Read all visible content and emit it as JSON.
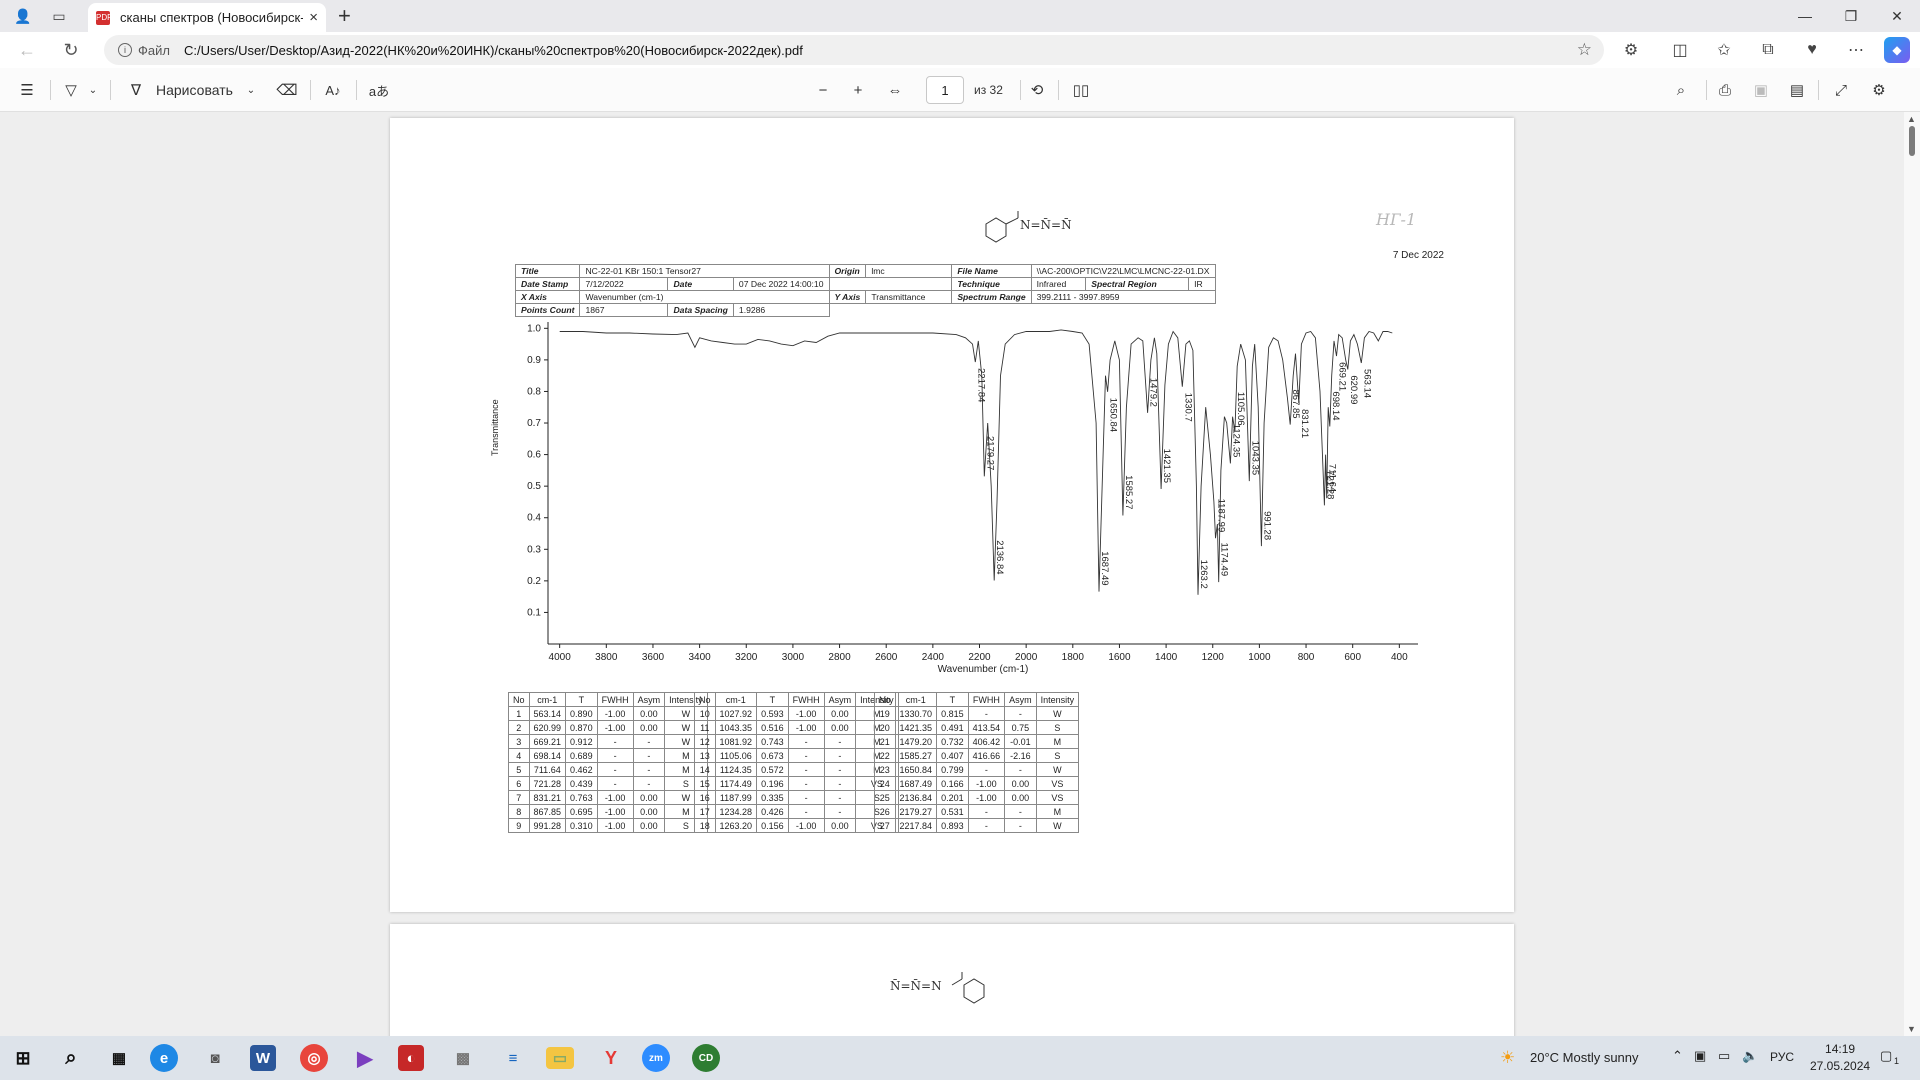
{
  "tab": {
    "title": "сканы спектров (Новосибирск-",
    "close": "×"
  },
  "window_controls": [
    "—",
    "❐",
    "✕"
  ],
  "address": {
    "file_label": "Файл",
    "url": "C:/Users/User/Desktop/Азид-2022(НК%20и%20ИНК)/сканы%20спектров%20(Новосибирск-2022дек).pdf"
  },
  "toolbar": {
    "draw_label": "Нарисовать",
    "page_current": "1",
    "page_total": "из 32"
  },
  "document": {
    "molecule_1": "N=N̄=N̄",
    "handwritten_id": "НГ-1",
    "date": "7 Dec 2022",
    "meta": {
      "title_k": "Title",
      "title_v": "NC-22-01 KBr 150:1 Tensor27",
      "datestamp_k": "Date Stamp",
      "datestamp_v": "7/12/2022",
      "date_k": "Date",
      "date_v": "07 Dec 2022 14:00:10",
      "xaxis_k": "X Axis",
      "xaxis_v": "Wavenumber (cm-1)",
      "points_k": "Points Count",
      "points_v": "1867",
      "spacing_k": "Data Spacing",
      "spacing_v": "1.9286",
      "origin_k": "Origin",
      "origin_v": "lmc",
      "yaxis_k": "Y Axis",
      "yaxis_v": "Transmittance",
      "file_k": "File Name",
      "file_v": "\\\\AC-200\\OPTIC\\V22\\LMC\\LMCNC-22-01.DX",
      "technique_k": "Technique",
      "technique_v": "Infrared",
      "region_k": "Spectral Region",
      "region_v": "IR",
      "range_k": "Spectrum Range",
      "range_v": "399.2111 - 3997.8959"
    },
    "molecule_2": "N̄=N̄=N"
  },
  "chart_data": {
    "type": "line",
    "title": "",
    "xlabel": "Wavenumber (cm-1)",
    "ylabel": "Transmittance",
    "xlim": [
      4050,
      320
    ],
    "ylim": [
      0,
      1.02
    ],
    "x_ticks": [
      4000,
      3800,
      3600,
      3400,
      3200,
      3000,
      2800,
      2600,
      2400,
      2200,
      2000,
      1800,
      1600,
      1400,
      1200,
      1000,
      800,
      600,
      400
    ],
    "y_ticks": [
      0.1,
      0.2,
      0.3,
      0.4,
      0.5,
      0.6,
      0.7,
      0.8,
      0.9,
      1.0
    ],
    "peak_labels": [
      {
        "x": 2217.84,
        "y": 0.893,
        "label": "2217.84"
      },
      {
        "x": 2179.27,
        "y": 0.531,
        "label": "2179.27"
      },
      {
        "x": 2136.84,
        "y": 0.201,
        "label": "2136.84"
      },
      {
        "x": 1687.49,
        "y": 0.166,
        "label": "1687.49"
      },
      {
        "x": 1650.84,
        "y": 0.799,
        "label": "1650.84"
      },
      {
        "x": 1585.27,
        "y": 0.407,
        "label": "1585.27"
      },
      {
        "x": 1479.2,
        "y": 0.732,
        "label": "1479.2"
      },
      {
        "x": 1421.35,
        "y": 0.491,
        "label": "1421.35"
      },
      {
        "x": 1330.7,
        "y": 0.815,
        "label": "1330.7"
      },
      {
        "x": 1263.2,
        "y": 0.156,
        "label": "1263.2"
      },
      {
        "x": 1187.99,
        "y": 0.335,
        "label": "1187.99"
      },
      {
        "x": 1174.49,
        "y": 0.196,
        "label": "1174.49"
      },
      {
        "x": 1124.35,
        "y": 0.572,
        "label": "1124.35"
      },
      {
        "x": 1105.06,
        "y": 0.673,
        "label": "1105.06"
      },
      {
        "x": 1043.35,
        "y": 0.516,
        "label": "1043.35"
      },
      {
        "x": 991.28,
        "y": 0.31,
        "label": "991.28"
      },
      {
        "x": 867.85,
        "y": 0.695,
        "label": "867.85"
      },
      {
        "x": 831.21,
        "y": 0.763,
        "label": "831.21"
      },
      {
        "x": 721.28,
        "y": 0.439,
        "label": "721.28"
      },
      {
        "x": 711.64,
        "y": 0.462,
        "label": "711.64"
      },
      {
        "x": 698.14,
        "y": 0.689,
        "label": "698.14"
      },
      {
        "x": 669.21,
        "y": 0.912,
        "label": "669.21"
      },
      {
        "x": 620.99,
        "y": 0.87,
        "label": "620.99"
      },
      {
        "x": 563.14,
        "y": 0.89,
        "label": "563.14"
      }
    ],
    "series": [
      {
        "x": [
          4000,
          3900,
          3800,
          3700,
          3600,
          3500,
          3450,
          3420,
          3400,
          3350,
          3300,
          3250,
          3200,
          3150,
          3100,
          3050,
          3000,
          2950,
          2900,
          2850,
          2800,
          2700,
          2600,
          2500,
          2400,
          2300,
          2260,
          2230,
          2217.84,
          2205,
          2190,
          2179.27,
          2165,
          2150,
          2136.84,
          2125,
          2110,
          2090,
          2050,
          2000,
          1950,
          1900,
          1850,
          1800,
          1760,
          1730,
          1700,
          1687.49,
          1670,
          1660,
          1650.84,
          1640,
          1620,
          1600,
          1585.27,
          1570,
          1550,
          1520,
          1500,
          1479.2,
          1465,
          1450,
          1440,
          1421.35,
          1405,
          1390,
          1370,
          1350,
          1330.7,
          1315,
          1300,
          1285,
          1270,
          1263.2,
          1250,
          1230,
          1210,
          1195,
          1187.99,
          1180,
          1174.49,
          1165,
          1150,
          1140,
          1124.35,
          1115,
          1105.06,
          1095,
          1080,
          1060,
          1043.35,
          1030,
          1020,
          1005,
          991.28,
          980,
          960,
          940,
          920,
          900,
          880,
          867.85,
          855,
          845,
          831.21,
          820,
          800,
          780,
          760,
          740,
          721.28,
          716,
          711.64,
          705,
          698.14,
          690,
          680,
          669.21,
          660,
          645,
          630,
          620.99,
          610,
          595,
          580,
          563.14,
          550,
          530,
          510,
          490,
          470,
          450,
          430
        ],
        "y": [
          0.99,
          0.99,
          0.985,
          0.985,
          0.982,
          0.98,
          0.985,
          0.94,
          0.97,
          0.96,
          0.955,
          0.95,
          0.95,
          0.965,
          0.96,
          0.95,
          0.945,
          0.96,
          0.955,
          0.975,
          0.985,
          0.985,
          0.985,
          0.985,
          0.985,
          0.98,
          0.97,
          0.95,
          0.893,
          0.96,
          0.85,
          0.531,
          0.7,
          0.5,
          0.201,
          0.45,
          0.85,
          0.95,
          0.98,
          0.99,
          0.99,
          0.99,
          0.995,
          0.99,
          0.985,
          0.95,
          0.7,
          0.166,
          0.6,
          0.85,
          0.799,
          0.9,
          0.96,
          0.9,
          0.407,
          0.75,
          0.95,
          0.97,
          0.96,
          0.732,
          0.9,
          0.97,
          0.92,
          0.491,
          0.82,
          0.95,
          0.99,
          0.97,
          0.815,
          0.95,
          0.96,
          0.93,
          0.5,
          0.156,
          0.5,
          0.75,
          0.6,
          0.45,
          0.335,
          0.38,
          0.196,
          0.55,
          0.72,
          0.7,
          0.572,
          0.72,
          0.673,
          0.88,
          0.95,
          0.9,
          0.516,
          0.88,
          0.95,
          0.75,
          0.31,
          0.7,
          0.94,
          0.97,
          0.96,
          0.9,
          0.78,
          0.695,
          0.85,
          0.92,
          0.763,
          0.95,
          0.985,
          0.99,
          0.97,
          0.8,
          0.439,
          0.6,
          0.462,
          0.75,
          0.689,
          0.85,
          0.96,
          0.912,
          0.98,
          0.97,
          0.9,
          0.87,
          0.96,
          0.98,
          0.95,
          0.89,
          0.97,
          0.99,
          0.985,
          0.96,
          0.99,
          0.99,
          0.985
        ]
      }
    ]
  },
  "peaks_table": {
    "headers": [
      "No",
      "cm-1",
      "T",
      "FWHH",
      "Asym",
      "Intensity"
    ],
    "columns": [
      [
        [
          "1",
          "563.14",
          "0.890",
          "-1.00",
          "0.00",
          "W"
        ],
        [
          "2",
          "620.99",
          "0.870",
          "-1.00",
          "0.00",
          "W"
        ],
        [
          "3",
          "669.21",
          "0.912",
          "-",
          "-",
          "W"
        ],
        [
          "4",
          "698.14",
          "0.689",
          "-",
          "-",
          "M"
        ],
        [
          "5",
          "711.64",
          "0.462",
          "-",
          "-",
          "M"
        ],
        [
          "6",
          "721.28",
          "0.439",
          "-",
          "-",
          "S"
        ],
        [
          "7",
          "831.21",
          "0.763",
          "-1.00",
          "0.00",
          "W"
        ],
        [
          "8",
          "867.85",
          "0.695",
          "-1.00",
          "0.00",
          "M"
        ],
        [
          "9",
          "991.28",
          "0.310",
          "-1.00",
          "0.00",
          "S"
        ]
      ],
      [
        [
          "10",
          "1027.92",
          "0.593",
          "-1.00",
          "0.00",
          "M"
        ],
        [
          "11",
          "1043.35",
          "0.516",
          "-1.00",
          "0.00",
          "M"
        ],
        [
          "12",
          "1081.92",
          "0.743",
          "-",
          "-",
          "M"
        ],
        [
          "13",
          "1105.06",
          "0.673",
          "-",
          "-",
          "M"
        ],
        [
          "14",
          "1124.35",
          "0.572",
          "-",
          "-",
          "M"
        ],
        [
          "15",
          "1174.49",
          "0.196",
          "-",
          "-",
          "VS"
        ],
        [
          "16",
          "1187.99",
          "0.335",
          "-",
          "-",
          "S"
        ],
        [
          "17",
          "1234.28",
          "0.426",
          "-",
          "-",
          "S"
        ],
        [
          "18",
          "1263.20",
          "0.156",
          "-1.00",
          "0.00",
          "VS"
        ]
      ],
      [
        [
          "19",
          "1330.70",
          "0.815",
          "-",
          "-",
          "W"
        ],
        [
          "20",
          "1421.35",
          "0.491",
          "413.54",
          "0.75",
          "S"
        ],
        [
          "21",
          "1479.20",
          "0.732",
          "406.42",
          "-0.01",
          "M"
        ],
        [
          "22",
          "1585.27",
          "0.407",
          "416.66",
          "-2.16",
          "S"
        ],
        [
          "23",
          "1650.84",
          "0.799",
          "-",
          "-",
          "W"
        ],
        [
          "24",
          "1687.49",
          "0.166",
          "-1.00",
          "0.00",
          "VS"
        ],
        [
          "25",
          "2136.84",
          "0.201",
          "-1.00",
          "0.00",
          "VS"
        ],
        [
          "26",
          "2179.27",
          "0.531",
          "-",
          "-",
          "M"
        ],
        [
          "27",
          "2217.84",
          "0.893",
          "-",
          "-",
          "W"
        ]
      ]
    ]
  },
  "taskbar": {
    "weather": "20°C Mostly sunny",
    "lang": "РУС",
    "time": "14:19",
    "date": "27.05.2024",
    "notif": "1"
  },
  "colors": {
    "accent": "#0a64c8",
    "pdf_red": "#d32f2f"
  }
}
